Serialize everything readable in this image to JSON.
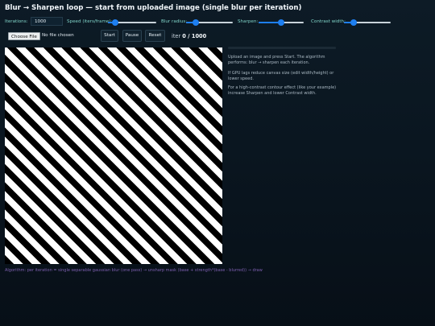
{
  "app": {
    "title": "Blur → Sharpen loop — start from uploaded image (single blur per iteration)"
  },
  "controls": {
    "iterations_label": "Iterations:",
    "iterations_value": "1000",
    "speed_label": "Speed (iters/frame):",
    "speed_level": 0.1,
    "blur_label": "Blur radius:",
    "blur_level": 0.15,
    "sharpen_label": "Sharpen:",
    "sharpen_level": 0.5,
    "contrast_label": "Contrast width:",
    "contrast_level": 0.15
  },
  "actions": {
    "choose_file": "Choose File",
    "no_file": "No file chosen",
    "start": "Start",
    "pause": "Pause",
    "reset": "Reset"
  },
  "status": {
    "iter_prefix": "iter",
    "iter_count": "0 / 1000",
    "progress": 0
  },
  "info": {
    "p1": "Upload an image and press Start. The algorithm performs: blur → sharpen each iteration.",
    "p2": "If GPU lags reduce canvas size (edit width/height) or lower speed.",
    "p3": "For a high-contrast contour effect (like your example) increase Sharpen and lower Contrast width."
  },
  "footer": {
    "text": "Algorithm: per iteration = single separable gaussian blur (one pass) → unsharp mask (base + strength*(base - blurred)) → draw"
  },
  "colors": {
    "accent": "#1e7ff0",
    "label": "#7fd3c8",
    "footer": "#7d5fb0"
  }
}
